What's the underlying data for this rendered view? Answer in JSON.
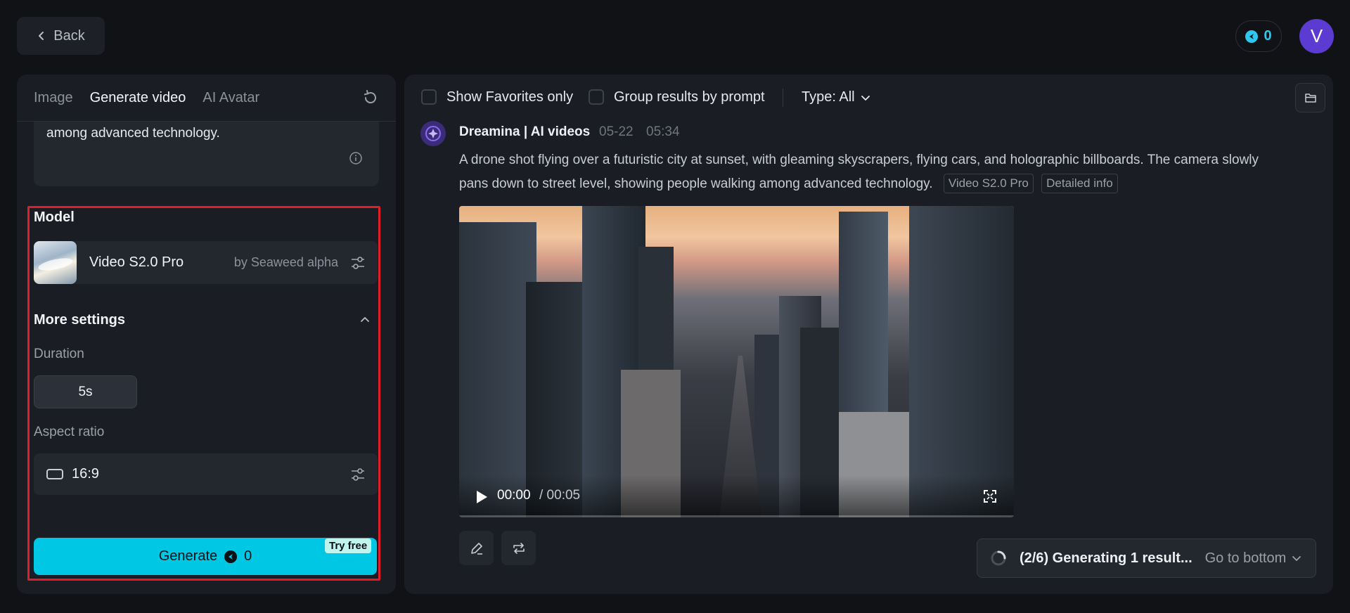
{
  "header": {
    "back_label": "Back",
    "credits": "0",
    "avatar_initial": "V"
  },
  "left_panel": {
    "tabs": [
      {
        "label": "Image"
      },
      {
        "label": "Generate video"
      },
      {
        "label": "AI Avatar"
      }
    ],
    "prompt_tail": "among advanced technology.",
    "model_section": {
      "title": "Model",
      "name": "Video S2.0 Pro",
      "by": "by Seaweed alpha"
    },
    "more_settings": {
      "title": "More settings",
      "duration_label": "Duration",
      "duration_value": "5s",
      "aspect_label": "Aspect ratio",
      "aspect_value": "16:9"
    },
    "generate": {
      "label": "Generate",
      "cost": "0",
      "badge": "Try free"
    }
  },
  "right_panel": {
    "filters": {
      "favorites_label": "Show Favorites only",
      "group_label": "Group results by prompt",
      "type_label": "Type: All"
    },
    "result": {
      "author": "Dreamina | AI videos",
      "date": "05-22",
      "time": "05:34",
      "prompt": "A drone shot flying over a futuristic city at sunset, with gleaming skyscrapers, flying cars, and holographic billboards. The camera slowly pans down to street level, showing people walking among advanced technology.",
      "tags": [
        "Video S2.0 Pro",
        "Detailed info"
      ],
      "video": {
        "current_time": "00:00",
        "total_time": "/ 00:05"
      }
    },
    "status": {
      "text": "(2/6) Generating 1 result...",
      "goto_label": "Go to bottom"
    }
  },
  "colors": {
    "accent": "#00c7e3",
    "highlight_frame": "#e11d2a",
    "avatar": "#5b3bd1"
  }
}
